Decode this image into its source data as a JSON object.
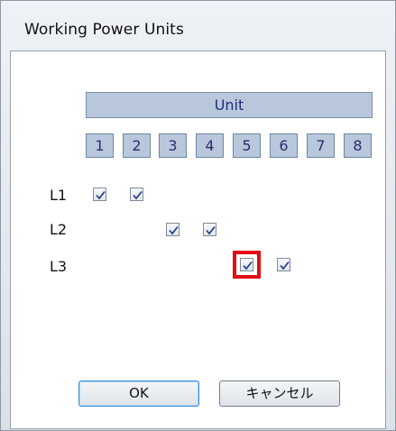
{
  "window": {
    "title": "Working Power Units"
  },
  "unit_header": "Unit",
  "units": [
    "1",
    "2",
    "3",
    "4",
    "5",
    "6",
    "7",
    "8"
  ],
  "rows": [
    {
      "label": "L1",
      "checked_units": [
        "1",
        "2"
      ]
    },
    {
      "label": "L2",
      "checked_units": [
        "3",
        "4"
      ]
    },
    {
      "label": "L3",
      "checked_units": [
        "5",
        "6"
      ]
    }
  ],
  "highlighted_checkbox": "L3 unit 5",
  "highlight_color": "#e30d16",
  "buttons": {
    "ok": "OK",
    "cancel": "キャンセル"
  }
}
